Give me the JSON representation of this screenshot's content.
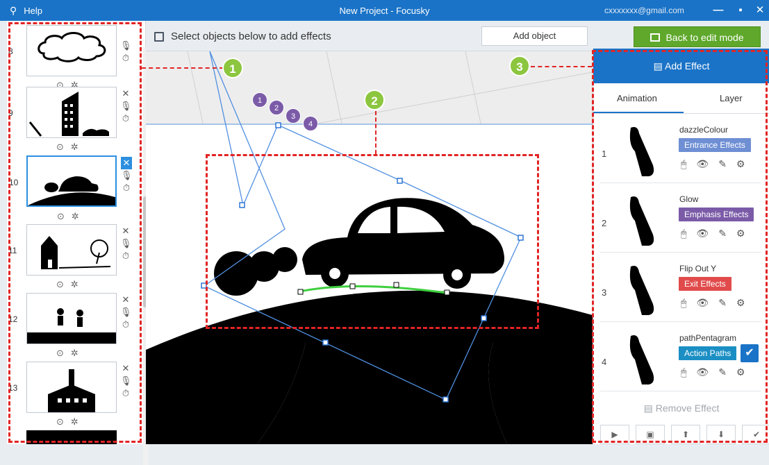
{
  "titlebar": {
    "menu_icon": "app-menu-icon",
    "help_label": "Help",
    "title": "New Project - Focusky",
    "user": "cxxxxxxx@gmail.com"
  },
  "toolbar": {
    "hint": "Select objects below to add effects",
    "add_object": "Add object",
    "back_edit": "Back to edit mode"
  },
  "thumbnails": [
    {
      "num": "8"
    },
    {
      "num": "9"
    },
    {
      "num": "10"
    },
    {
      "num": "11"
    },
    {
      "num": "12"
    },
    {
      "num": "13"
    }
  ],
  "callouts": {
    "one": "1",
    "two": "2",
    "three": "3"
  },
  "path_points": [
    "1",
    "2",
    "3",
    "4"
  ],
  "panel": {
    "add_effect": "Add Effect",
    "tab_animation": "Animation",
    "tab_layer": "Layer",
    "effects": [
      {
        "n": "1",
        "name": "dazzleColour",
        "tag": "Entrance Effects",
        "color": "#6e8fd4"
      },
      {
        "n": "2",
        "name": "Glow",
        "tag": "Emphasis Effects",
        "color": "#7b5ba8"
      },
      {
        "n": "3",
        "name": "Flip Out Y",
        "tag": "Exit Effects",
        "color": "#e14b4b"
      },
      {
        "n": "4",
        "name": "pathPentagram",
        "tag": "Action Paths",
        "color": "#1b8fc4"
      }
    ],
    "remove_effect": "Remove Effect"
  },
  "colors": {
    "accent": "#1a73c7",
    "green": "#5fa82b",
    "callout": "#8cc63f",
    "dash": "#e22424"
  }
}
